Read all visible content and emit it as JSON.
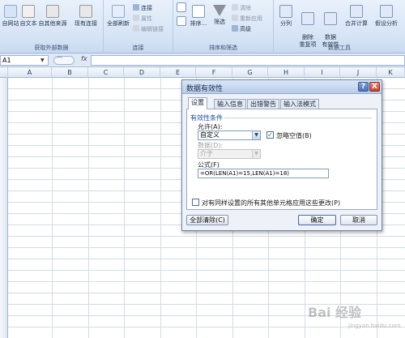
{
  "ribbon": {
    "group_external": {
      "title": "获取外部数据",
      "buttons": [
        "自网站",
        "自文本",
        "自其他来源",
        "现有连接"
      ]
    },
    "group_connections": {
      "title": "连接",
      "refresh_all": "全部刷新",
      "items": [
        "连接",
        "属性",
        "编辑链接"
      ]
    },
    "group_sort_filter": {
      "title": "排序和筛选",
      "sort_label": "排序...",
      "filter_label": "筛选",
      "items": [
        "清除",
        "重新应用",
        "高级"
      ]
    },
    "group_data_tools": {
      "title": "数据工具",
      "buttons": [
        "分列",
        "删除\n重复项",
        "数据\n有效性"
      ],
      "merge": "合并计算",
      "whatif": "假设分析"
    }
  },
  "formula_bar": {
    "cell_ref": "A1",
    "fx_label": "fx",
    "formula": ""
  },
  "columns": [
    "A",
    "B",
    "C",
    "D",
    "E",
    "F",
    "G",
    "H",
    "I",
    "J",
    "K"
  ],
  "dialog": {
    "title": "数据有效性",
    "help_label": "?",
    "close_label": "X",
    "tabs": [
      "设置",
      "输入信息",
      "出错警告",
      "输入法模式"
    ],
    "active_tab": "设置",
    "section_title": "有效性条件",
    "allow_label": "允许(A):",
    "allow_value": "自定义",
    "ignore_blank_label": "忽略空值(B)",
    "ignore_blank_checked": true,
    "data_label": "数据(D):",
    "data_value": "介于",
    "formula_label": "公式(F)",
    "formula_value": "=OR(LEN(A1)=15,LEN(A1)=18)",
    "apply_all_label": "对有同样设置的所有其他单元格应用这些更改(P)",
    "apply_all_checked": false,
    "clear_all_button": "全部清除(C)",
    "ok_button": "确定",
    "cancel_button": "取消"
  },
  "watermark": {
    "text": "Bai 经验",
    "sub": "jingyan.baidu.com"
  }
}
